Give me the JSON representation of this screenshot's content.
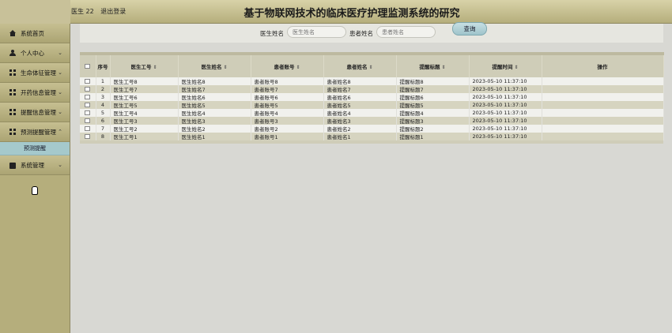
{
  "header": {
    "user_label": "医生 22",
    "logout_label": "退出登录",
    "title": "基于物联网技术的临床医疗护理监测系统的研究"
  },
  "sidebar": {
    "items": [
      {
        "label": "系统首页",
        "icon": "home-icon",
        "chevron": ""
      },
      {
        "label": "个人中心",
        "icon": "user-icon",
        "chevron": "⌄"
      },
      {
        "label": "生命体征管理",
        "icon": "grid-icon",
        "chevron": "⌄"
      },
      {
        "label": "开药信息管理",
        "icon": "grid-icon",
        "chevron": "⌄"
      },
      {
        "label": "提醒信息管理",
        "icon": "grid-icon",
        "chevron": "⌄"
      },
      {
        "label": "预测提醒管理",
        "icon": "grid-icon",
        "chevron": "⌃"
      },
      {
        "label": "系统管理",
        "icon": "system-icon",
        "chevron": "⌄"
      }
    ],
    "submenu": {
      "label": "预测提醒"
    }
  },
  "search": {
    "doctor_name_label": "医生姓名",
    "doctor_name_placeholder": "医生姓名",
    "patient_name_label": "患者姓名",
    "patient_name_placeholder": "患者姓名",
    "query_button": "查询"
  },
  "table": {
    "columns": [
      "序号",
      "医生工号",
      "医生姓名",
      "患者账号",
      "患者姓名",
      "提醒标题",
      "提醒时间",
      "操作"
    ],
    "sort_glyph": "⇕",
    "rows": [
      [
        "1",
        "医生工号8",
        "医生姓名8",
        "患者账号8",
        "患者姓名8",
        "提醒标题8",
        "2023-05-10 11:37:10"
      ],
      [
        "2",
        "医生工号7",
        "医生姓名7",
        "患者账号7",
        "患者姓名7",
        "提醒标题7",
        "2023-05-10 11:37:10"
      ],
      [
        "3",
        "医生工号6",
        "医生姓名6",
        "患者账号6",
        "患者姓名6",
        "提醒标题6",
        "2023-05-10 11:37:10"
      ],
      [
        "4",
        "医生工号5",
        "医生姓名5",
        "患者账号5",
        "患者姓名5",
        "提醒标题5",
        "2023-05-10 11:37:10"
      ],
      [
        "5",
        "医生工号4",
        "医生姓名4",
        "患者账号4",
        "患者姓名4",
        "提醒标题4",
        "2023-05-10 11:37:10"
      ],
      [
        "6",
        "医生工号3",
        "医生姓名3",
        "患者账号3",
        "患者姓名3",
        "提醒标题3",
        "2023-05-10 11:37:10"
      ],
      [
        "7",
        "医生工号2",
        "医生姓名2",
        "患者账号2",
        "患者姓名2",
        "提醒标题2",
        "2023-05-10 11:37:10"
      ],
      [
        "8",
        "医生工号1",
        "医生姓名1",
        "患者账号1",
        "患者姓名1",
        "提醒标题1",
        "2023-05-10 11:37:10"
      ]
    ]
  },
  "colors": {
    "header_bg": "#b5ae7c",
    "sidebar_bg": "#b5ae7c",
    "submenu_bg": "#a5c9cc",
    "table_header_bg": "#cfcdb8",
    "row_even_bg": "#d6d4c0",
    "row_odd_bg": "#f1f1ed"
  }
}
